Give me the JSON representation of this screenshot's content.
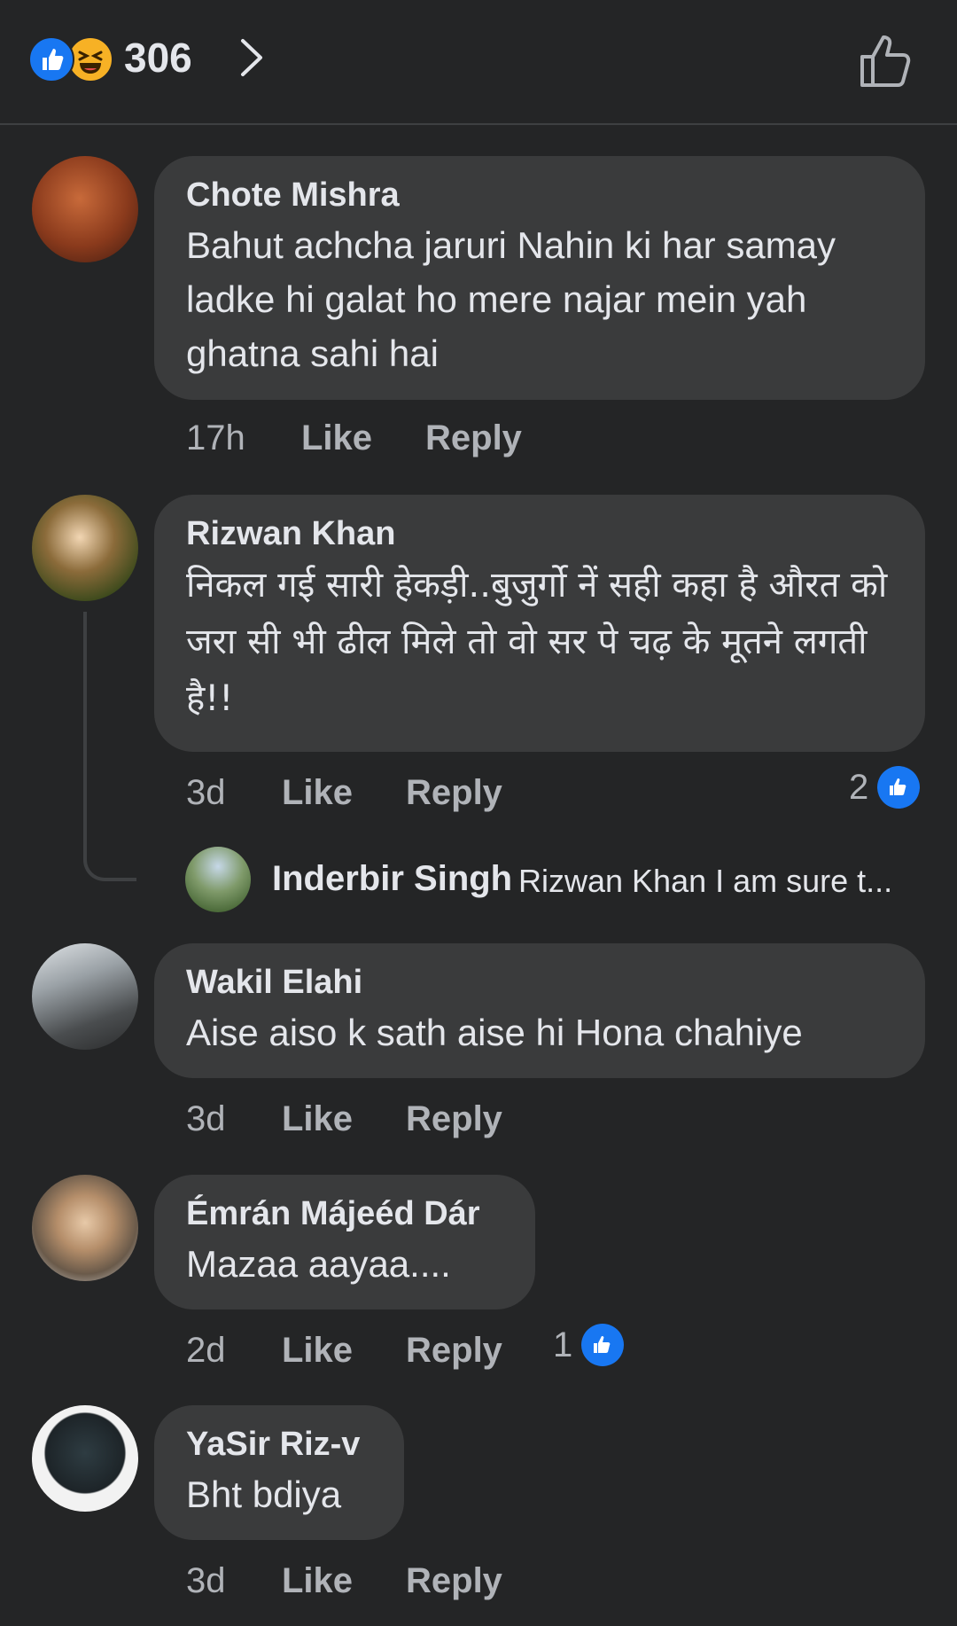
{
  "header": {
    "reaction_icons": [
      "like-reaction",
      "haha-reaction"
    ],
    "reaction_count": "306",
    "chevron_icon": "chevron-right",
    "like_button_icon": "thumbs-up-outline"
  },
  "colors": {
    "background": "#242526",
    "bubble": "#3a3b3c",
    "primary_text": "#e4e6eb",
    "secondary_text": "#b0b3b8",
    "like_blue": "#1877f2",
    "haha_yellow": "#f7b125"
  },
  "comments": [
    {
      "author": "Chote Mishra",
      "text": "Bahut achcha jaruri Nahin ki har samay ladke hi galat ho mere najar mein yah ghatna sahi hai",
      "time": "17h",
      "like_label": "Like",
      "reply_label": "Reply"
    },
    {
      "author": "Rizwan Khan",
      "text": "निकल गई सारी हेकड़ी..बुजुर्गो नें सही कहा है औरत को जरा सी भी ढील मिले तो वो सर पे चढ़ के मूतने लगती है!!",
      "time": "3d",
      "like_label": "Like",
      "reply_label": "Reply",
      "like_count": "2",
      "reply_preview": {
        "author": "Inderbir Singh",
        "snippet": "Rizwan Khan I am sure t..."
      }
    },
    {
      "author": "Wakil Elahi",
      "text": "Aise aiso k sath aise hi Hona chahiye",
      "time": "3d",
      "like_label": "Like",
      "reply_label": "Reply"
    },
    {
      "author": "Émrán Májeéd Dár",
      "text": "Mazaa aayaa....",
      "time": "2d",
      "like_label": "Like",
      "reply_label": "Reply",
      "like_count": "1"
    },
    {
      "author": "YaSir Riz-v",
      "text": "Bht bdiya",
      "time": "3d",
      "like_label": "Like",
      "reply_label": "Reply"
    }
  ]
}
